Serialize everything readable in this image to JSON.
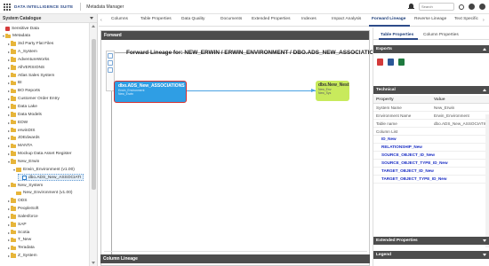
{
  "app": {
    "brand": "DATA INTELLIGENCE SUITE",
    "title": "Metadata Manager",
    "search_placeholder": "Search"
  },
  "left_panel": {
    "title": "System Catalogue",
    "tree": [
      {
        "label": "Sensitive Data",
        "icon": "lock-icon",
        "level": 0,
        "toggle": ""
      },
      {
        "label": "Metadata",
        "icon": "folder-icon",
        "level": 0,
        "toggle": "▾"
      },
      {
        "label": "3rd Party Flat Files",
        "icon": "folder-icon",
        "level": 1,
        "toggle": "▸"
      },
      {
        "label": "A_System",
        "icon": "folder-icon",
        "level": 1,
        "toggle": "▸"
      },
      {
        "label": "AdventureWorks",
        "icon": "folder-icon",
        "level": 1,
        "toggle": "▸"
      },
      {
        "label": "AllVERSIONS",
        "icon": "folder-icon",
        "level": 1,
        "toggle": "▸"
      },
      {
        "label": "Atlas Sales System",
        "icon": "folder-icon",
        "level": 1,
        "toggle": "▸"
      },
      {
        "label": "BI",
        "icon": "folder-icon",
        "level": 1,
        "toggle": "▸"
      },
      {
        "label": "BO Reports",
        "icon": "folder-icon",
        "level": 1,
        "toggle": "▸"
      },
      {
        "label": "Customer Order Entry",
        "icon": "folder-icon",
        "level": 1,
        "toggle": "▸"
      },
      {
        "label": "Data Lake",
        "icon": "folder-icon",
        "level": 1,
        "toggle": "▸"
      },
      {
        "label": "Data Models",
        "icon": "folder-icon",
        "level": 1,
        "toggle": "▸"
      },
      {
        "label": "EDW",
        "icon": "folder-icon",
        "level": 1,
        "toggle": "▸"
      },
      {
        "label": "erwinDIS",
        "icon": "folder-icon",
        "level": 1,
        "toggle": "▸"
      },
      {
        "label": "JDEdwards",
        "icon": "folder-icon",
        "level": 1,
        "toggle": "▸"
      },
      {
        "label": "MANTA",
        "icon": "folder-icon",
        "level": 1,
        "toggle": "▸"
      },
      {
        "label": "Mockup Data Asset Register",
        "icon": "folder-icon",
        "level": 1,
        "toggle": "▸"
      },
      {
        "label": "New_Erwin",
        "icon": "folder-icon",
        "level": 1,
        "toggle": "▾"
      },
      {
        "label": "Erwin_Environment (v1.00)",
        "icon": "env-icon",
        "level": 2,
        "toggle": "▾"
      },
      {
        "label": "dbo.ADS_New_ASSOCIATI",
        "icon": "table-icon",
        "level": 3,
        "toggle": "",
        "selected": true
      },
      {
        "label": "New_System",
        "icon": "folder-icon",
        "level": 1,
        "toggle": "▾"
      },
      {
        "label": "New_Environment (v1.00)",
        "icon": "env-icon",
        "level": 2,
        "toggle": ""
      },
      {
        "label": "ODS",
        "icon": "folder-icon",
        "level": 1,
        "toggle": "▸"
      },
      {
        "label": "PeopleSoft",
        "icon": "folder-icon",
        "level": 1,
        "toggle": "▸"
      },
      {
        "label": "Salesforce",
        "icon": "folder-icon",
        "level": 1,
        "toggle": "▸"
      },
      {
        "label": "SAP",
        "icon": "folder-icon",
        "level": 1,
        "toggle": "▸"
      },
      {
        "label": "Scotia",
        "icon": "folder-icon",
        "level": 1,
        "toggle": "▸"
      },
      {
        "label": "T_New",
        "icon": "folder-icon",
        "level": 1,
        "toggle": "▸"
      },
      {
        "label": "Teradata",
        "icon": "folder-icon",
        "level": 1,
        "toggle": "▸"
      },
      {
        "label": "Z_System",
        "icon": "folder-icon",
        "level": 1,
        "toggle": "▸"
      }
    ]
  },
  "tabs": [
    "Columns",
    "Table Properties",
    "Data Quality",
    "Documents",
    "Extended Properties",
    "Indexes",
    "Impact Analysis",
    "Forward Lineage",
    "Reverse Lineage",
    "Text Specific"
  ],
  "active_tab": "Forward Lineage",
  "forward_panel": {
    "header": "Forward",
    "title": "Forward Lineage for: NEW_ERWIN / ERWIN_ENVIRONMENT / DBO.ADS_NEW_ASSOCIATIONS",
    "source_node": {
      "name": "dbo.ADS_New_ASSOCIATIONS",
      "sub1": "Erwin_Environment",
      "sub2": "New_Erwin"
    },
    "target_node": {
      "name": "dbo.New_Nest",
      "sub1": "New_Env",
      "sub2": "New_Sys"
    },
    "column_lineage_label": "Column Lineage"
  },
  "right_panel": {
    "tabs": [
      "Table Properties",
      "Column Properties"
    ],
    "exports_label": "Exports",
    "technical_label": "Technical",
    "table_headers": [
      "Property",
      "Value"
    ],
    "properties": [
      {
        "name": "System Name",
        "value": "New_Erwin"
      },
      {
        "name": "Environment Name",
        "value": "Erwin_Environment"
      },
      {
        "name": "Table name",
        "value": "dbo.ADS_New_ASSOCIATIONS"
      },
      {
        "name": "Column List",
        "value": ""
      }
    ],
    "columns": [
      "ID_New",
      "RELATIONSHIP_New",
      "SOURCE_OBJECT_ID_New",
      "SOURCE_OBJECT_TYPE_ID_New",
      "TARGET_OBJECT_ID_New",
      "TARGET_OBJECT_TYPE_ID_New"
    ],
    "extended_label": "Extended Properties",
    "legend_label": "Legend"
  },
  "colors": {
    "brand": "#2d4b8a",
    "dark_header": "#4d4d4d",
    "source_node": "#2f9ee4",
    "target_node": "#c8ea5c",
    "column_link": "#1b2fc4"
  }
}
